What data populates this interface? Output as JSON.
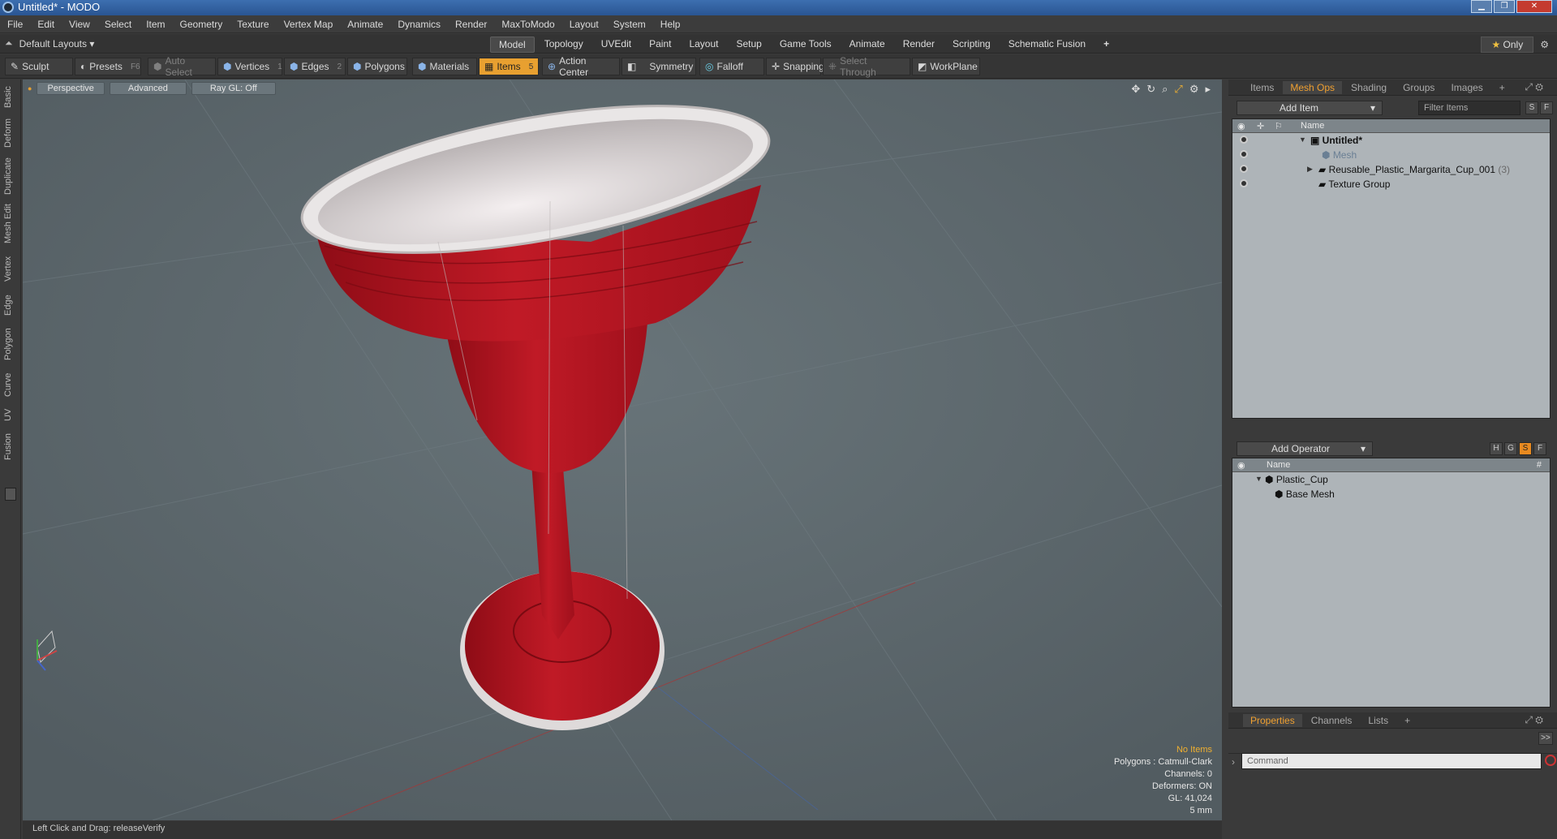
{
  "window": {
    "title": "Untitled* - MODO"
  },
  "menu": [
    "File",
    "Edit",
    "View",
    "Select",
    "Item",
    "Geometry",
    "Texture",
    "Vertex Map",
    "Animate",
    "Dynamics",
    "Render",
    "MaxToModo",
    "Layout",
    "System",
    "Help"
  ],
  "modebar": {
    "layout_label": "Default Layouts",
    "tabs": [
      "Model",
      "Topology",
      "UVEdit",
      "Paint",
      "Layout",
      "Setup",
      "Game Tools",
      "Animate",
      "Render",
      "Scripting",
      "Schematic Fusion"
    ],
    "active_tab": "Model",
    "add_tab": "+",
    "only_label": "Only"
  },
  "toolbar": {
    "sculpt": "Sculpt",
    "presets": "Presets",
    "presets_key": "F6",
    "auto_select": "Auto Select",
    "vertices": "Vertices",
    "vertices_key": "1",
    "edges": "Edges",
    "edges_key": "2",
    "polygons": "Polygons",
    "materials": "Materials",
    "items": "Items",
    "items_key": "5",
    "action_center": "Action Center",
    "symmetry": "Symmetry",
    "falloff": "Falloff",
    "snapping": "Snapping",
    "select_through": "Select Through",
    "workplane": "WorkPlane"
  },
  "left_tabs": [
    "Basic",
    "Deform",
    "Duplicate",
    "Mesh Edit",
    "Vertex",
    "Edge",
    "Polygon",
    "Curve",
    "UV",
    "Fusion"
  ],
  "viewport": {
    "view": "Perspective",
    "shading": "Advanced",
    "raygl": "Ray GL: Off",
    "info": {
      "no_items": "No Items",
      "polygons": "Polygons : Catmull-Clark",
      "channels": "Channels: 0",
      "deformers": "Deformers: ON",
      "gl": "GL: 41,024",
      "scale": "5 mm"
    },
    "colors": {
      "cup_red": "#b5141f",
      "rim_white": "#e9e6e6",
      "background": "#5e6a70"
    }
  },
  "status": {
    "text": "Left Click and Drag:  releaseVerify"
  },
  "item_panel": {
    "tabs": [
      "Items",
      "Mesh Ops",
      "Shading",
      "Groups",
      "Images"
    ],
    "active_tab": "Mesh Ops",
    "add_tab": "+",
    "add_item": "Add Item",
    "filter": "Filter Items",
    "s_btn": "S",
    "f_btn": "F",
    "column_name": "Name",
    "rows": [
      {
        "label": "Untitled*"
      },
      {
        "label": "Mesh"
      },
      {
        "label": "Reusable_Plastic_Margarita_Cup_001",
        "count": "(3)"
      },
      {
        "label": "Texture Group"
      }
    ]
  },
  "operator_panel": {
    "add_operator": "Add Operator",
    "h_btn": "H",
    "g_btn": "G",
    "s_btn": "S",
    "f_btn": "F",
    "column_name": "Name",
    "column_hash": "#",
    "rows": [
      {
        "label": "Plastic_Cup"
      },
      {
        "label": "Base Mesh"
      }
    ]
  },
  "properties_panel": {
    "tabs": [
      "Properties",
      "Channels",
      "Lists"
    ],
    "active_tab": "Properties",
    "add_tab": "+",
    "expand": ">>"
  },
  "command": {
    "placeholder": "Command"
  }
}
